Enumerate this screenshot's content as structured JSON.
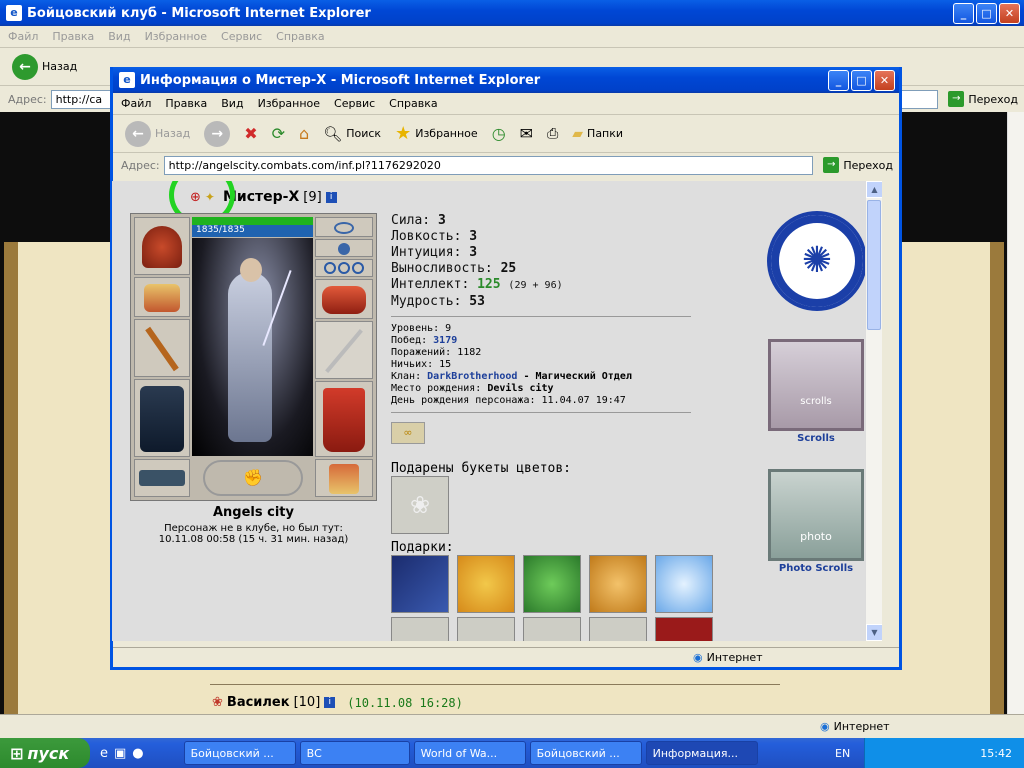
{
  "back_window": {
    "title": "Бойцовский клуб - Microsoft Internet Explorer",
    "menu": [
      "Файл",
      "Правка",
      "Вид",
      "Избранное",
      "Сервис",
      "Справка"
    ],
    "back_label": "Назад",
    "address_label": "Адрес:",
    "address_value": "http://ca",
    "go_label": "Переход",
    "status_zone": "Интернет",
    "player2_name": "Василек",
    "player2_level": "[10]",
    "player2_time": "(10.11.08 16:28)"
  },
  "popup": {
    "title": "Информация о Мистер-X - Microsoft Internet Explorer",
    "menu": [
      "Файл",
      "Правка",
      "Вид",
      "Избранное",
      "Сервис",
      "Справка"
    ],
    "toolbar": {
      "back": "Назад",
      "search": "Поиск",
      "favorites": "Избранное",
      "folders": "Папки"
    },
    "address_label": "Адрес:",
    "address_value": "http://angelscity.combats.com/inf.pl?1176292020",
    "go_label": "Переход",
    "status_zone": "Интернет"
  },
  "character": {
    "name": "Мистер-X",
    "level": "[9]",
    "hp": "1835/1835",
    "city": "Angels city",
    "presence": "Персонаж не в клубе, но был тут:",
    "last_seen": "10.11.08 00:58 (15 ч. 31 мин. назад)",
    "stats": [
      {
        "label": "Сила:",
        "value": "3",
        "extra": ""
      },
      {
        "label": "Ловкость:",
        "value": "3",
        "extra": ""
      },
      {
        "label": "Интуиция:",
        "value": "3",
        "extra": ""
      },
      {
        "label": "Выносливость:",
        "value": "25",
        "extra": ""
      },
      {
        "label": "Интеллект:",
        "value": "125",
        "extra": "(29 + 96)"
      },
      {
        "label": "Мудрость:",
        "value": "53",
        "extra": ""
      }
    ],
    "level_line": "Уровень: 9",
    "wins_label": "Побед:",
    "wins_value": "3179",
    "losses": "Поражений: 1182",
    "draws": "Ничьих: 15",
    "clan_label": "Клан:",
    "clan_value": "DarkBrotherhood",
    "clan_extra": "- Магический Отдел",
    "birthplace_label": "Место рождения:",
    "birthplace_value": "Devils city",
    "birthday": "День рождения персонажа: 11.04.07 19:47",
    "flowers_title": "Подарены букеты цветов:",
    "gifts_title": "Подарки:",
    "side_scrolls": "Scrolls",
    "side_photo": "Photo Scrolls",
    "scroll_text": "scrolls",
    "photo_text": "photo"
  },
  "taskbar": {
    "start": "пуск",
    "tasks": [
      "Бойцовский ...",
      "ВС",
      "World of Wa...",
      "Бойцовский ...",
      "Информация..."
    ],
    "lang": "EN",
    "time": "15:42"
  },
  "colors": {
    "accent": "#0054e3",
    "highlight": "#22d322",
    "clan": "#1d3f9a"
  }
}
